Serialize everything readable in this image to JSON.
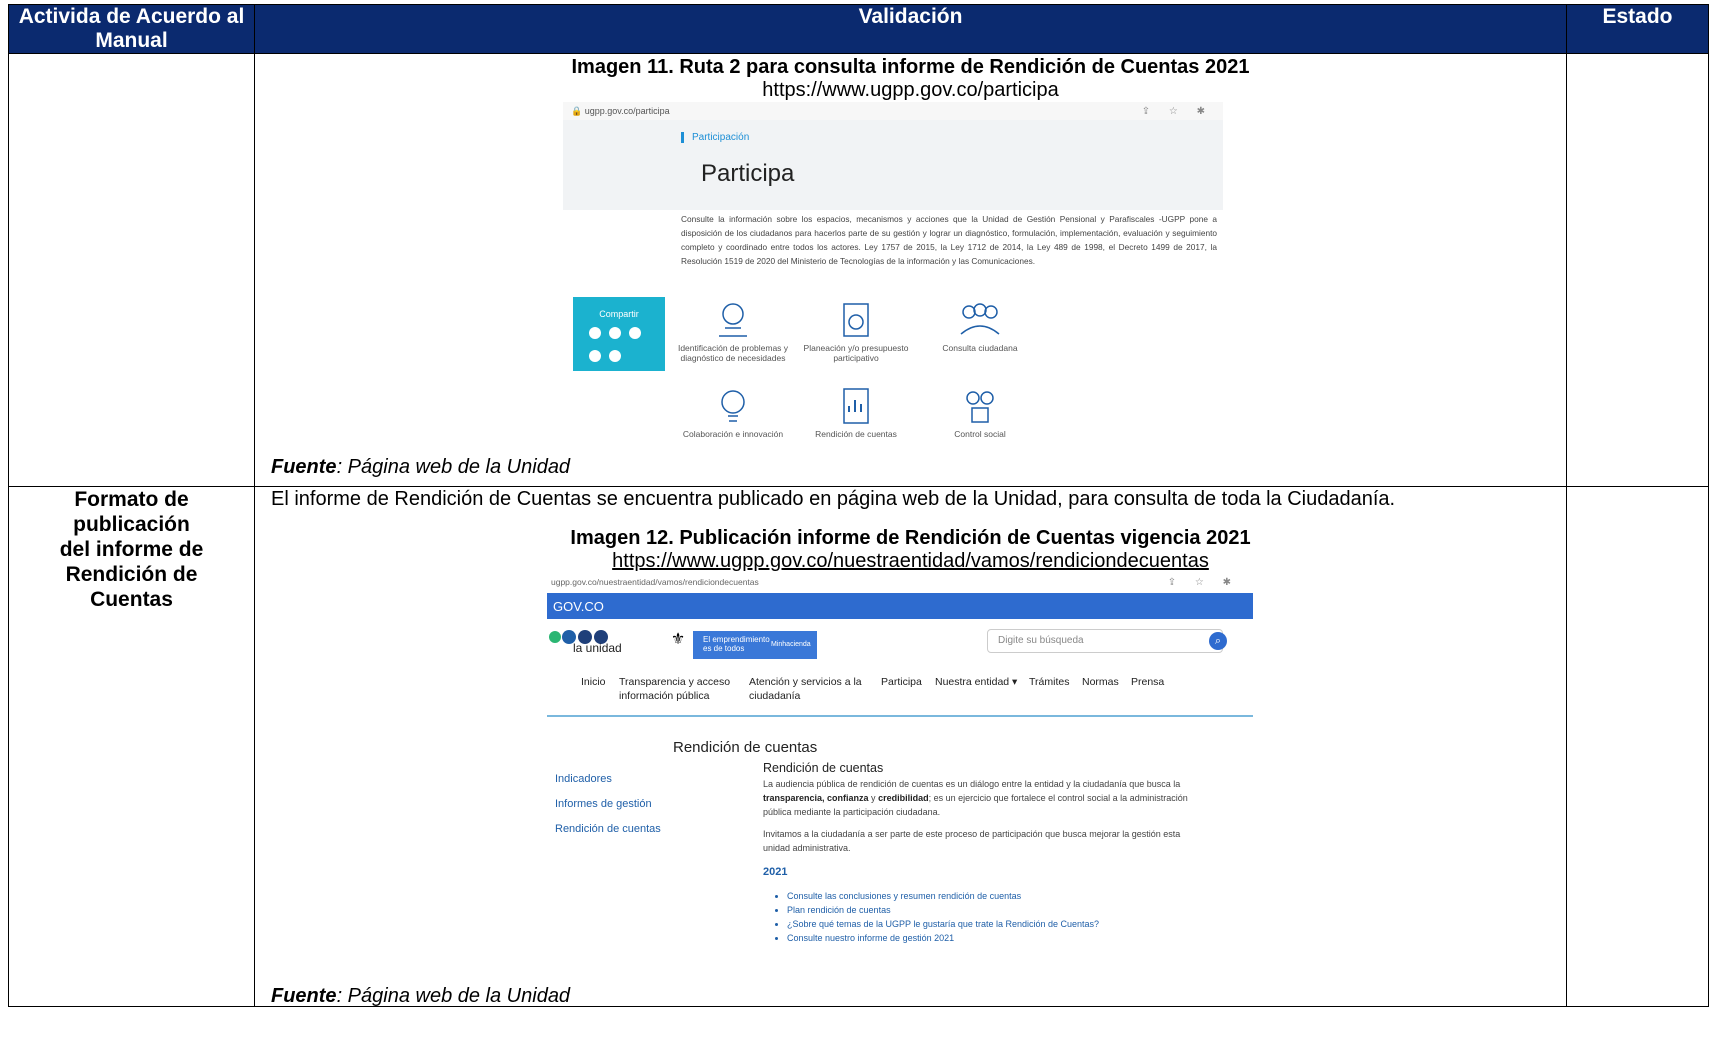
{
  "header": {
    "col1": "Activida de Acuerdo al Manual",
    "col2": "Validación",
    "col3": "Estado"
  },
  "row1": {
    "caption_title": "Imagen 11. Ruta 2 para consulta informe de Rendición de Cuentas 2021",
    "caption_url": "https://www.ugpp.gov.co/participa",
    "fuente_label": "Fuente",
    "fuente_text": ": Página web de la Unidad",
    "screenshot": {
      "address": "ugpp.gov.co/participa",
      "browser_icons": "⇪ ☆ ✱",
      "breadcrumb": "Participación",
      "title": "Participa",
      "description": "Consulte la información sobre los espacios, mecanismos y acciones que la Unidad de Gestión Pensional y Parafiscales -UGPP pone a disposición de los ciudadanos para hacerlos parte de su gestión y lograr un diagnóstico, formulación, implementación, evaluación y seguimiento completo y coordinado entre todos los actores. Ley 1757 de 2015, la Ley 1712 de 2014, la Ley 489 de 1998, el Decreto 1499 de 2017, la Resolución 1519 de 2020 del Ministerio de Tecnologías de la información y las Comunicaciones.",
      "share_label": "Compartir",
      "items": [
        "Identificación de problemas y diagnóstico de necesidades",
        "Planeación y/o presupuesto participativo",
        "Consulta ciudadana",
        "Colaboración e innovación",
        "Rendición de cuentas",
        "Control social"
      ]
    }
  },
  "row2": {
    "label": "Formato de publicación del informe de Rendición de Cuentas",
    "intro": "El informe de Rendición de Cuentas se encuentra publicado en página web de la Unidad, para consulta de toda la Ciudadanía.",
    "caption_title": "Imagen 12. Publicación informe de Rendición de Cuentas vigencia 2021",
    "caption_url": "https://www.ugpp.gov.co/nuestraentidad/vamos/rendiciondecuentas",
    "fuente_label": "Fuente",
    "fuente_text": ": Página web de la Unidad",
    "screenshot": {
      "address": "ugpp.gov.co/nuestraentidad/vamos/rendiciondecuentas",
      "browser_icons": "⇪ ☆ ✱",
      "gov": "GOV.CO",
      "logo_text": "la unidad",
      "emp_line1": "El emprendimiento",
      "emp_line2": "es de todos",
      "emp_ministry": "Minhacienda",
      "search_placeholder": "Digite su búsqueda",
      "nav": {
        "inicio": "Inicio",
        "transparencia_1": "Transparencia y acceso",
        "transparencia_2": "información pública",
        "atencion_1": "Atención y servicios a la",
        "atencion_2": "ciudadanía",
        "participa": "Participa",
        "entidad": "Nuestra entidad ▾",
        "tramites": "Trámites",
        "normas": "Normas",
        "prensa": "Prensa"
      },
      "page_heading": "Rendición de cuentas",
      "side_links": [
        "Indicadores",
        "Informes de gestión",
        "Rendición de cuentas"
      ],
      "content_heading": "Rendición de cuentas",
      "para1_a": "La audiencia pública de rendición de cuentas es un diálogo entre la entidad y la ciudadanía que busca la ",
      "para1_b1": "transparencia, confianza",
      "para1_c": " y ",
      "para1_b2": "credibilidad",
      "para1_d": "; es un ejercicio que fortalece el control social a la administración pública mediante la participación ciudadana.",
      "para2": "Invitamos a la ciudadanía a ser parte de este proceso de participación que busca mejorar la gestión esta unidad administrativa.",
      "year": "2021",
      "links": [
        "Consulte las conclusiones y resumen rendición de cuentas",
        "Plan rendición de cuentas",
        "¿Sobre qué temas de la UGPP le gustaría que trate la Rendición de Cuentas?",
        "Consulte nuestro informe de gestión 2021"
      ]
    }
  },
  "colors": {
    "header_bg": "#0b2a6f",
    "share_tile": "#1bb2cf",
    "gov_bar": "#2e6bcf",
    "link": "#1f5fa8"
  }
}
